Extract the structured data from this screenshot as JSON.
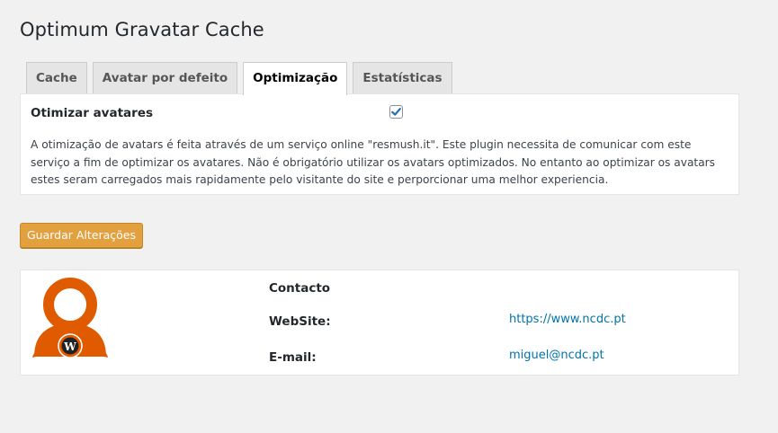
{
  "page": {
    "title": "Optimum Gravatar Cache"
  },
  "tabs": [
    {
      "label": "Cache",
      "active": false
    },
    {
      "label": "Avatar por defeito",
      "active": false
    },
    {
      "label": "Optimização",
      "active": true
    },
    {
      "label": "Estatísticas",
      "active": false
    }
  ],
  "optimization": {
    "label": "Otimizar avatares",
    "checked": true,
    "description": "A otimização de avatars é feita através de um serviço online \"resmush.it\". Este plugin necessita de comunicar com este serviço a fim de optimizar os avatares. Não é obrigatório utilizar os avatars optimizados. No entanto ao optimizar os avatars estes seram carregados mais rapidamente pelo visitante do site e perporcionar uma melhor experiencia."
  },
  "buttons": {
    "save_label": "Guardar Alterações"
  },
  "contact": {
    "heading": "Contacto",
    "website_label": "WebSite:",
    "website_value": "https://www.ncdc.pt",
    "email_label": "E-mail:",
    "email_value": "miguel@ncdc.pt"
  },
  "colors": {
    "accent_button": "#e3a03f",
    "logo_orange": "#e05a00",
    "link": "#0073aa",
    "checkbox_blue": "#2271b1"
  },
  "icons": {
    "logo": "gravatar-person-wordpress-logo",
    "checkbox": "checkmark-icon"
  }
}
